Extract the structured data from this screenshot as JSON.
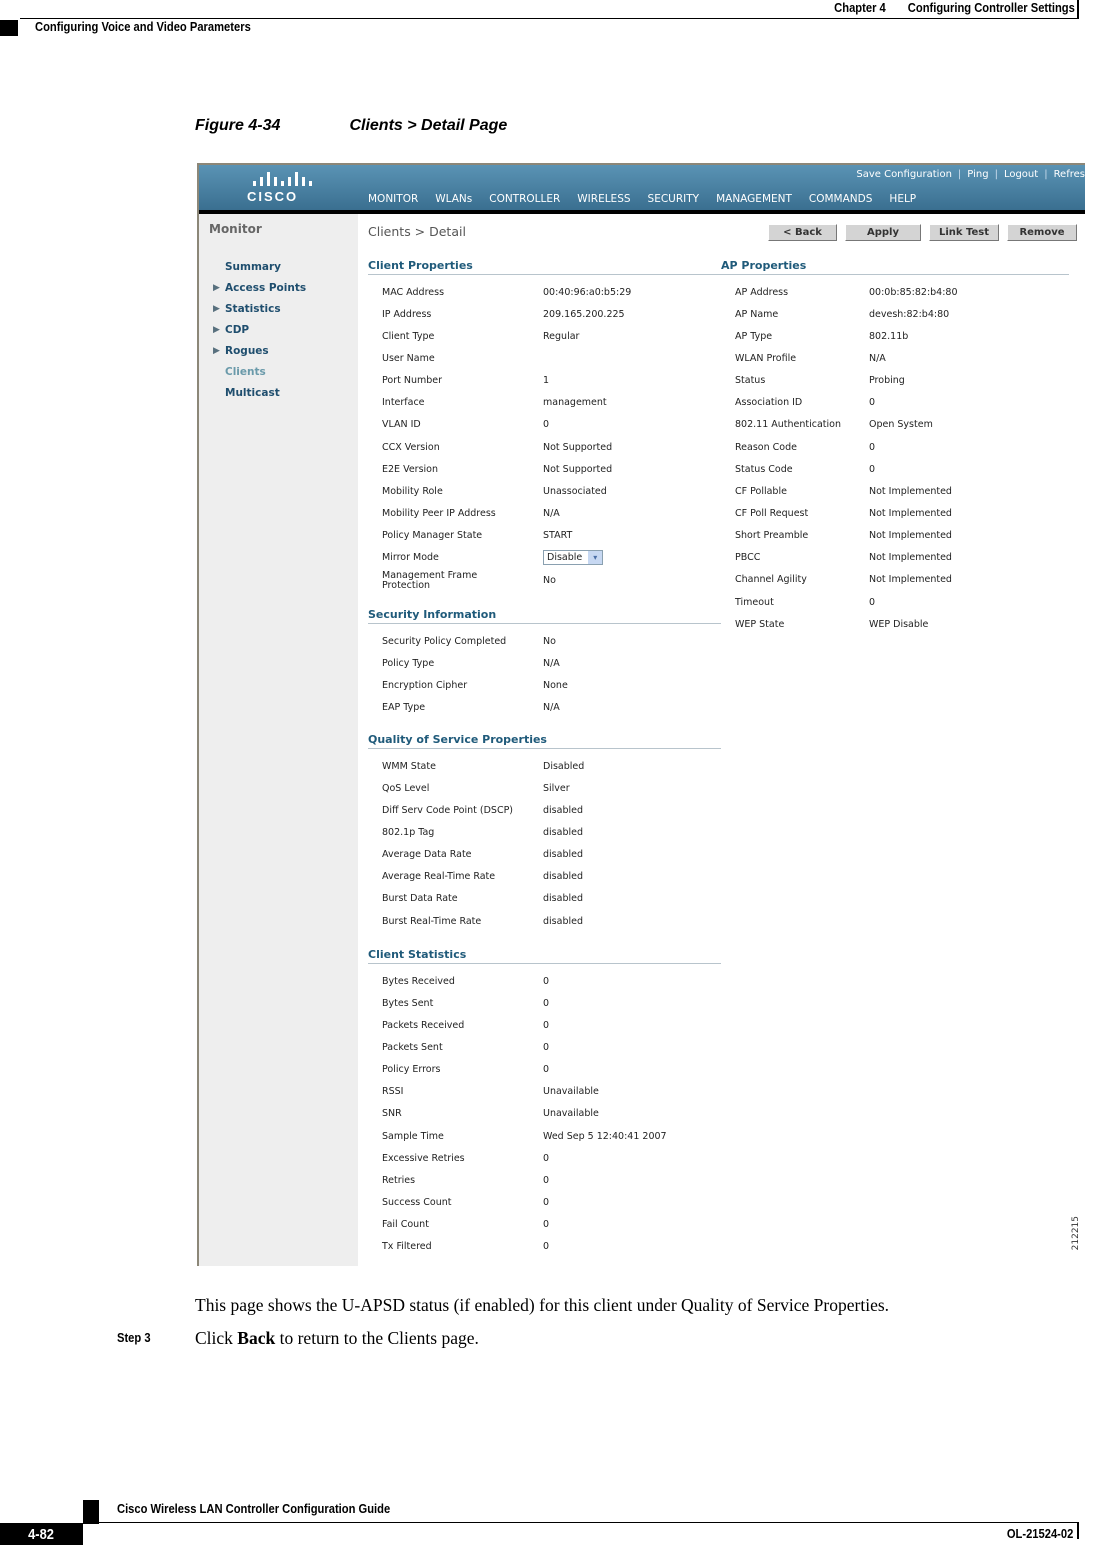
{
  "doc_header": {
    "chapter": "Chapter 4",
    "chapter_title": "Configuring Controller Settings",
    "section": "Configuring Voice and Video Parameters"
  },
  "figure": {
    "number": "Figure 4-34",
    "title": "Clients > Detail Page",
    "figure_id": "212215"
  },
  "app": {
    "brand": "CISCO",
    "util_links": [
      "Save Configuration",
      "Ping",
      "Logout",
      "Refres"
    ],
    "nav": [
      {
        "label": "MONITOR",
        "active": true
      },
      {
        "label": "WLANs"
      },
      {
        "label": "CONTROLLER"
      },
      {
        "label": "WIRELESS"
      },
      {
        "label": "SECURITY"
      },
      {
        "label": "MANAGEMENT"
      },
      {
        "label": "COMMANDS"
      },
      {
        "label": "HELP"
      }
    ],
    "sidebar": {
      "title": "Monitor",
      "items": [
        {
          "label": "Summary",
          "expandable": false
        },
        {
          "label": "Access Points",
          "expandable": true
        },
        {
          "label": "Statistics",
          "expandable": true
        },
        {
          "label": "CDP",
          "expandable": true
        },
        {
          "label": "Rogues",
          "expandable": true
        },
        {
          "label": "Clients",
          "expandable": false,
          "current": true
        },
        {
          "label": "Multicast",
          "expandable": false
        }
      ]
    },
    "page_title": "Clients > Detail",
    "buttons": {
      "back": "< Back",
      "apply": "Apply",
      "link_test": "Link Test",
      "remove": "Remove"
    },
    "client_properties": {
      "title": "Client Properties",
      "rows": [
        {
          "k": "MAC Address",
          "v": "00:40:96:a0:b5:29"
        },
        {
          "k": "IP Address",
          "v": "209.165.200.225"
        },
        {
          "k": "Client Type",
          "v": "Regular"
        },
        {
          "k": "User Name",
          "v": ""
        },
        {
          "k": "Port Number",
          "v": "1"
        },
        {
          "k": "Interface",
          "v": "management"
        },
        {
          "k": "VLAN ID",
          "v": "0"
        },
        {
          "k": "CCX Version",
          "v": "Not Supported"
        },
        {
          "k": "E2E Version",
          "v": "Not Supported"
        },
        {
          "k": "Mobility Role",
          "v": "Unassociated"
        },
        {
          "k": "Mobility Peer IP Address",
          "v": "N/A"
        },
        {
          "k": "Policy Manager State",
          "v": "START"
        },
        {
          "k": "Mirror Mode",
          "v": "Disable"
        },
        {
          "k": "Management Frame Protection",
          "v": "No"
        }
      ]
    },
    "security_information": {
      "title": "Security Information",
      "rows": [
        {
          "k": "Security Policy Completed",
          "v": "No"
        },
        {
          "k": "Policy Type",
          "v": "N/A"
        },
        {
          "k": "Encryption Cipher",
          "v": "None"
        },
        {
          "k": "EAP Type",
          "v": "N/A"
        }
      ]
    },
    "qos_properties": {
      "title": "Quality of Service Properties",
      "rows": [
        {
          "k": "WMM State",
          "v": "Disabled"
        },
        {
          "k": "QoS Level",
          "v": "Silver"
        },
        {
          "k": "Diff Serv Code Point (DSCP)",
          "v": "disabled"
        },
        {
          "k": "802.1p Tag",
          "v": "disabled"
        },
        {
          "k": "Average Data Rate",
          "v": "disabled"
        },
        {
          "k": "Average Real-Time Rate",
          "v": "disabled"
        },
        {
          "k": "Burst Data Rate",
          "v": "disabled"
        },
        {
          "k": "Burst Real-Time Rate",
          "v": "disabled"
        }
      ]
    },
    "client_statistics": {
      "title": "Client Statistics",
      "rows": [
        {
          "k": "Bytes Received",
          "v": "0"
        },
        {
          "k": "Bytes Sent",
          "v": "0"
        },
        {
          "k": "Packets Received",
          "v": "0"
        },
        {
          "k": "Packets Sent",
          "v": "0"
        },
        {
          "k": "Policy Errors",
          "v": "0"
        },
        {
          "k": "RSSI",
          "v": "Unavailable"
        },
        {
          "k": "SNR",
          "v": "Unavailable"
        },
        {
          "k": "Sample Time",
          "v": "Wed Sep  5 12:40:41 2007"
        },
        {
          "k": "Excessive Retries",
          "v": "0"
        },
        {
          "k": "Retries",
          "v": "0"
        },
        {
          "k": "Success Count",
          "v": "0"
        },
        {
          "k": "Fail Count",
          "v": "0"
        },
        {
          "k": "Tx Filtered",
          "v": "0"
        }
      ]
    },
    "ap_properties": {
      "title": "AP Properties",
      "rows": [
        {
          "k": "AP Address",
          "v": "00:0b:85:82:b4:80"
        },
        {
          "k": "AP Name",
          "v": "devesh:82:b4:80"
        },
        {
          "k": "AP Type",
          "v": "802.11b"
        },
        {
          "k": "WLAN Profile",
          "v": "N/A"
        },
        {
          "k": "Status",
          "v": "Probing"
        },
        {
          "k": "Association ID",
          "v": "0"
        },
        {
          "k": "802.11 Authentication",
          "v": "Open System"
        },
        {
          "k": "Reason Code",
          "v": "0"
        },
        {
          "k": "Status Code",
          "v": "0"
        },
        {
          "k": "CF Pollable",
          "v": "Not Implemented"
        },
        {
          "k": "CF Poll Request",
          "v": "Not Implemented"
        },
        {
          "k": "Short Preamble",
          "v": "Not Implemented"
        },
        {
          "k": "PBCC",
          "v": "Not Implemented"
        },
        {
          "k": "Channel Agility",
          "v": "Not Implemented"
        },
        {
          "k": "Timeout",
          "v": "0"
        },
        {
          "k": "WEP State",
          "v": "WEP Disable"
        }
      ]
    }
  },
  "body": {
    "paragraph": "This page shows the U-APSD status (if enabled) for this client under Quality of Service Properties.",
    "step_label": "Step 3",
    "step_prefix": "Click ",
    "step_bold": "Back",
    "step_suffix": " to return to the Clients page."
  },
  "footer": {
    "guide_title": "Cisco Wireless LAN Controller Configuration Guide",
    "page_number": "4-82",
    "doc_number": "OL-21524-02"
  }
}
